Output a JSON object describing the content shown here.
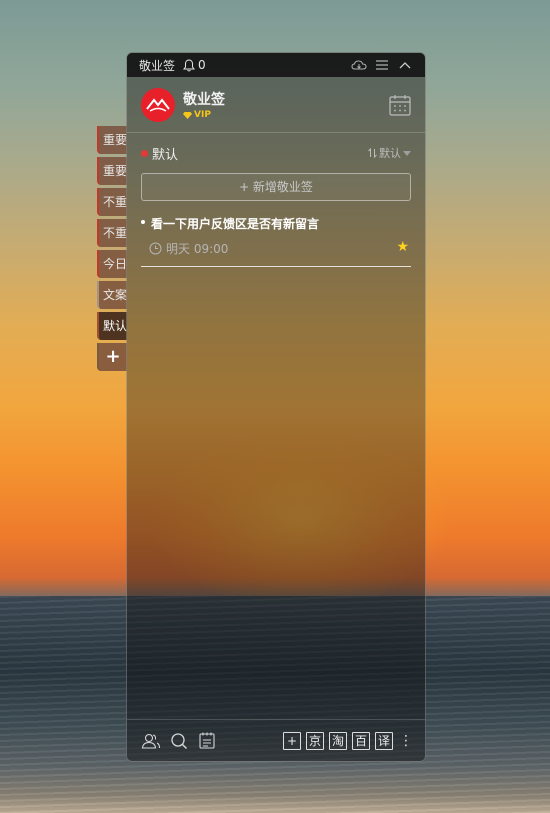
{
  "window": {
    "title": "敬业签",
    "notification_count": "0"
  },
  "profile": {
    "name": "敬业签",
    "badge": "VIP"
  },
  "side_tabs": [
    {
      "label": "重要"
    },
    {
      "label": "重要"
    },
    {
      "label": "不重"
    },
    {
      "label": "不重"
    },
    {
      "label": "今日"
    },
    {
      "label": "文案"
    },
    {
      "label": "默认"
    },
    {
      "label": "+"
    }
  ],
  "group": {
    "name": "默认",
    "sort_label": "默认"
  },
  "add_button": {
    "label": "+ 新增敬业签"
  },
  "notes": [
    {
      "text": "看一下用户反馈区是否有新留言",
      "reminder": "明天 09:00",
      "starred": true
    }
  ],
  "bottom_buttons": [
    "+",
    "京",
    "淘",
    "百",
    "译"
  ],
  "colors": {
    "accent_red": "#e8202a",
    "star_yellow": "#ffd21f",
    "vip_gold": "#f5c518"
  }
}
